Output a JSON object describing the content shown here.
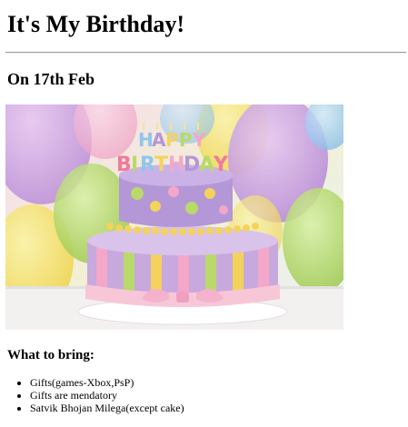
{
  "header": {
    "title": "It's My Birthday!"
  },
  "subheader": {
    "date": "On 17th Feb"
  },
  "image": {
    "subject": "birthday-cake-image",
    "topper_line1": "HAPPY",
    "topper_line2": "BIRTHDAY",
    "colors": {
      "purple": "#b497d6",
      "green": "#b9d96a",
      "yellow": "#f3d35c",
      "pink": "#f4a7c8",
      "blue": "#8ec6ec",
      "ribbon": "#f7c7d8"
    }
  },
  "bring": {
    "heading": "What to bring:",
    "items": [
      "Gifts(games-Xbox,PsP)",
      "Gifts are mendatory",
      "Satvik Bhojan Milega(except cake)"
    ]
  }
}
